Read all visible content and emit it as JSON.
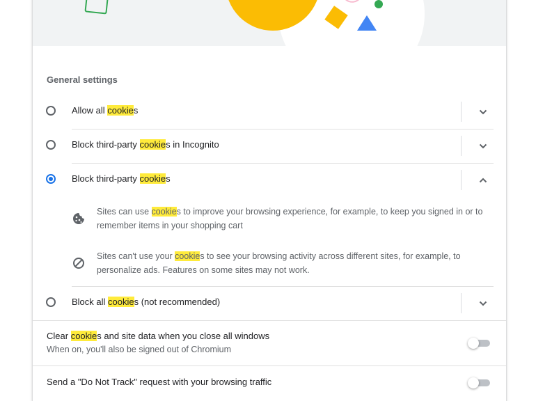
{
  "colors": {
    "accent": "#1a73e8",
    "highlight": "#ffeb3b",
    "secondary_text": "#5f6368",
    "banner_background": "#f1f3f4"
  },
  "section_title": "General settings",
  "search_highlight": "cookie",
  "options": [
    {
      "prefix": "Allow all ",
      "match": "cookie",
      "suffix": "s",
      "selected": false,
      "expanded": false,
      "icon": "chevron-down-icon"
    },
    {
      "prefix": "Block third-party ",
      "match": "cookie",
      "suffix": "s in Incognito",
      "selected": false,
      "expanded": false,
      "icon": "chevron-down-icon"
    },
    {
      "prefix": "Block third-party ",
      "match": "cookie",
      "suffix": "s",
      "selected": true,
      "expanded": true,
      "icon": "chevron-up-icon"
    },
    {
      "prefix": "Block all ",
      "match": "cookie",
      "suffix": "s (not recommended)",
      "selected": false,
      "expanded": false,
      "icon": "chevron-down-icon"
    }
  ],
  "details": [
    {
      "icon": "cookie-icon",
      "prefix": "Sites can use ",
      "match": "cookie",
      "suffix": "s to improve your browsing experience, for example, to keep you signed in or to remember items in your shopping cart"
    },
    {
      "icon": "block-icon",
      "prefix": "Sites can't use your ",
      "match": "cookie",
      "suffix": "s to see your browsing activity across different sites, for example, to personalize ads. Features on some sites may not work."
    }
  ],
  "clear_on_exit": {
    "prefix": "Clear ",
    "match": "cookie",
    "suffix": "s and site data when you close all windows",
    "subtitle": "When on, you'll also be signed out of Chromium",
    "enabled": false
  },
  "do_not_track": {
    "title": "Send a \"Do Not Track\" request with your browsing traffic",
    "enabled": false
  }
}
